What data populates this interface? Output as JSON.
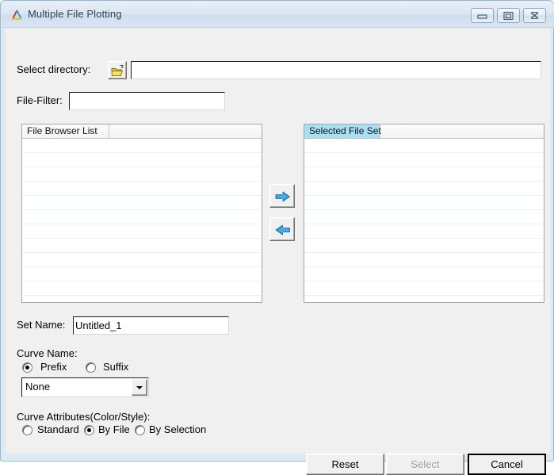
{
  "window": {
    "title": "Multiple File Plotting",
    "icon": "triangle-logo-icon",
    "controls": {
      "minimize": "minimize-icon",
      "maximize": "maximize-icon",
      "close": "close-icon"
    }
  },
  "form": {
    "directory_label": "Select directory:",
    "directory_value": "",
    "directory_placeholder": "",
    "browse_icon": "open-folder-icon",
    "filter_label": "File-Filter:",
    "filter_value": "",
    "filter_placeholder": "",
    "setname_label": "Set Name:",
    "setname_value": "Untitled_1",
    "setname_placeholder": ""
  },
  "lists": {
    "left": {
      "header": "File Browser List",
      "header_selected": false,
      "rows": []
    },
    "right": {
      "header": "Selected File Set",
      "header_selected": true,
      "rows": []
    }
  },
  "transfer": {
    "add_icon": "arrow-right-icon",
    "add_title": "Add to selected file set",
    "remove_icon": "arrow-left-icon",
    "remove_title": "Remove from selected file set"
  },
  "curve_name": {
    "group_label": "Curve Name:",
    "options": [
      {
        "label": "Prefix",
        "selected": true
      },
      {
        "label": "Suffix",
        "selected": false
      }
    ],
    "dropdown_value": "None",
    "dropdown_options": [
      "None"
    ]
  },
  "curve_attributes": {
    "group_label": "Curve Attributes(Color/Style):",
    "options": [
      {
        "label": "Standard",
        "selected": false
      },
      {
        "label": "By File",
        "selected": true
      },
      {
        "label": "By Selection",
        "selected": false
      }
    ]
  },
  "actions": {
    "reset": "Reset",
    "select": "Select",
    "select_disabled": true,
    "cancel": "Cancel"
  },
  "colors": {
    "title_text": "#2b4257",
    "window_border": "#9bb8cf",
    "panel_bg": "#f0f0f0",
    "header_highlight": "#a7e0f5",
    "arrow_blue": "#1f7fc0",
    "folder_yellow": "#e8d11a"
  }
}
